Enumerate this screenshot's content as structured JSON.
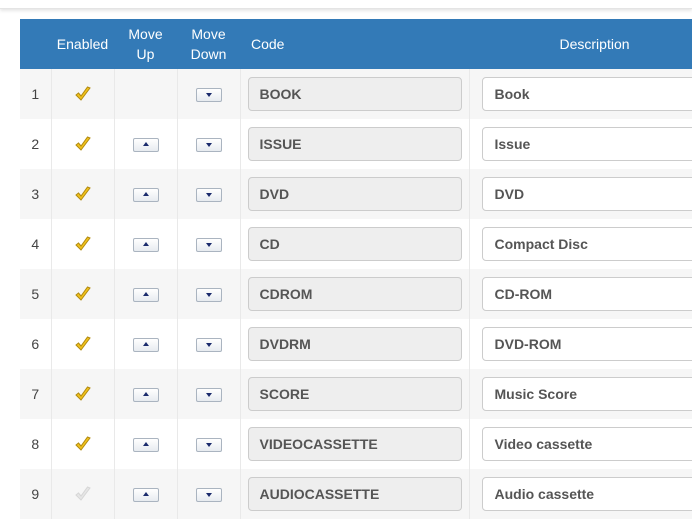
{
  "headers": {
    "index": "",
    "enabled": "Enabled",
    "move_up_line1": "Move",
    "move_up_line2": "Up",
    "move_down_line1": "Move",
    "move_down_line2": "Down",
    "code": "Code",
    "description": "Description"
  },
  "colors": {
    "header_bg": "#337ab7",
    "check_enabled": "#f2c21c",
    "check_disabled": "#e6e6e6"
  },
  "rows": [
    {
      "num": "1",
      "enabled": true,
      "has_up": false,
      "code": "BOOK",
      "description": "Book"
    },
    {
      "num": "2",
      "enabled": true,
      "has_up": true,
      "code": "ISSUE",
      "description": "Issue"
    },
    {
      "num": "3",
      "enabled": true,
      "has_up": true,
      "code": "DVD",
      "description": "DVD"
    },
    {
      "num": "4",
      "enabled": true,
      "has_up": true,
      "code": "CD",
      "description": "Compact Disc"
    },
    {
      "num": "5",
      "enabled": true,
      "has_up": true,
      "code": "CDROM",
      "description": "CD-ROM"
    },
    {
      "num": "6",
      "enabled": true,
      "has_up": true,
      "code": "DVDRM",
      "description": "DVD-ROM"
    },
    {
      "num": "7",
      "enabled": true,
      "has_up": true,
      "code": "SCORE",
      "description": "Music Score"
    },
    {
      "num": "8",
      "enabled": true,
      "has_up": true,
      "code": "VIDEOCASSETTE",
      "description": "Video cassette"
    },
    {
      "num": "9",
      "enabled": false,
      "has_up": true,
      "code": "AUDIOCASSETTE",
      "description": "Audio cassette"
    }
  ]
}
